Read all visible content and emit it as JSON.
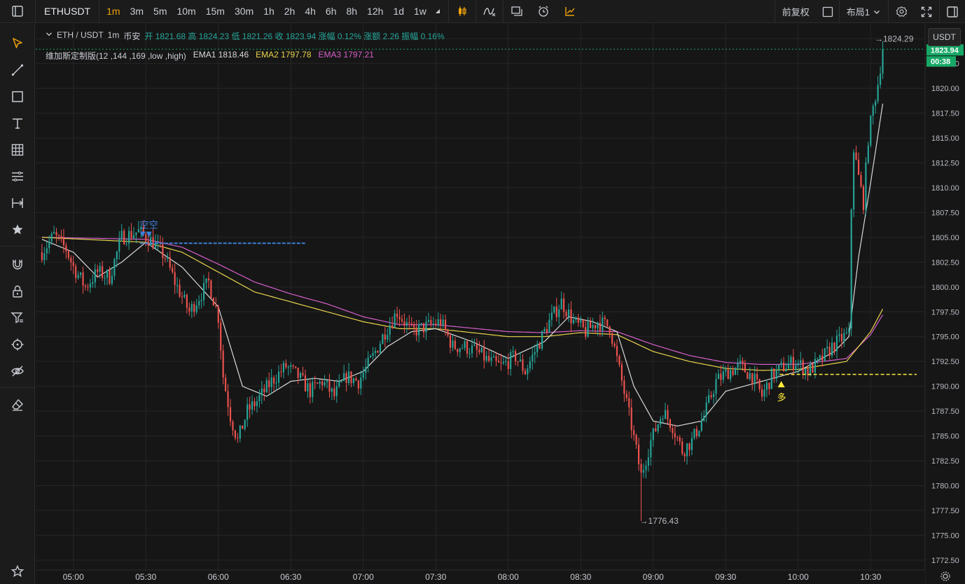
{
  "toolbar": {
    "symbol": "ETHUSDT",
    "intervals": [
      "1m",
      "3m",
      "5m",
      "10m",
      "15m",
      "30m",
      "1h",
      "2h",
      "4h",
      "6h",
      "8h",
      "12h",
      "1d",
      "1w"
    ],
    "active_interval": "1m",
    "adjust_label": "前复权",
    "layout_label": "布局1"
  },
  "legend": {
    "pair": "ETH / USDT",
    "interval": "1m",
    "exchange": "币安",
    "ohlc": "开 1821.68 高 1824.23 低 1821.26 收 1823.94 涨幅 0.12% 涨额 2.26 振幅 0.16%",
    "indicator": "维加斯定制版(12 ,144 ,169 ,low ,high)",
    "ema1_label": "EMA1 1818.46",
    "ema2_label": "EMA2 1797.78",
    "ema3_label": "EMA3 1797.21"
  },
  "currency": "USDT",
  "colors": {
    "up": "#26a69a",
    "down": "#ef5350",
    "ema1": "#d9d9d9",
    "ema2": "#e8d44d",
    "ema3": "#d65fcb",
    "price_tag": "#17a866"
  },
  "chart_data": {
    "type": "candlestick",
    "x_ticks": [
      "05:00",
      "05:30",
      "06:00",
      "06:30",
      "07:00",
      "07:30",
      "08:00",
      "08:30",
      "09:00",
      "09:30",
      "10:00",
      "10:30"
    ],
    "y_ticks": [
      1825.0,
      1822.5,
      1820.0,
      1817.5,
      1815.0,
      1812.5,
      1810.0,
      1807.5,
      1805.0,
      1802.5,
      1800.0,
      1797.5,
      1795.0,
      1792.5,
      1790.0,
      1787.5,
      1785.0,
      1782.5,
      1780.0,
      1777.5,
      1775.0,
      1772.5
    ],
    "ylim": [
      1771.5,
      1826.5
    ],
    "last_price": "1823.94",
    "countdown": "00:38",
    "high_label": "1824.29",
    "low_label": "1776.43",
    "short_signal": {
      "label": "空空",
      "time": "05:31",
      "price": 1804.8
    },
    "long_signal": {
      "label": "多",
      "time": "09:53",
      "price": 1790.6
    },
    "short_level": 1804.4,
    "long_level": 1791.2,
    "price_keyframes": [
      [
        "04:47",
        1803.5
      ],
      [
        "04:52",
        1805.2
      ],
      [
        "04:57",
        1803.8
      ],
      [
        "05:00",
        1802.0
      ],
      [
        "05:05",
        1800.0
      ],
      [
        "05:10",
        1801.5
      ],
      [
        "05:15",
        1801.0
      ],
      [
        "05:20",
        1805.0
      ],
      [
        "05:27",
        1805.6
      ],
      [
        "05:33",
        1804.5
      ],
      [
        "05:38",
        1803.0
      ],
      [
        "05:42",
        1800.5
      ],
      [
        "05:48",
        1797.5
      ],
      [
        "05:52",
        1799.0
      ],
      [
        "05:56",
        1800.5
      ],
      [
        "06:00",
        1797.0
      ],
      [
        "06:02",
        1791.0
      ],
      [
        "06:05",
        1787.0
      ],
      [
        "06:08",
        1784.5
      ],
      [
        "06:12",
        1787.5
      ],
      [
        "06:16",
        1788.5
      ],
      [
        "06:22",
        1790.5
      ],
      [
        "06:28",
        1792.0
      ],
      [
        "06:33",
        1791.0
      ],
      [
        "06:38",
        1789.5
      ],
      [
        "06:43",
        1790.5
      ],
      [
        "06:48",
        1789.0
      ],
      [
        "06:53",
        1791.0
      ],
      [
        "06:58",
        1790.5
      ],
      [
        "07:04",
        1793.0
      ],
      [
        "07:09",
        1795.5
      ],
      [
        "07:14",
        1797.5
      ],
      [
        "07:20",
        1795.5
      ],
      [
        "07:26",
        1796.0
      ],
      [
        "07:32",
        1796.5
      ],
      [
        "07:37",
        1794.0
      ],
      [
        "07:42",
        1794.0
      ],
      [
        "07:47",
        1793.5
      ],
      [
        "07:52",
        1792.5
      ],
      [
        "07:57",
        1792.0
      ],
      [
        "08:03",
        1793.0
      ],
      [
        "08:07",
        1791.5
      ],
      [
        "08:12",
        1794.0
      ],
      [
        "08:17",
        1796.5
      ],
      [
        "08:22",
        1798.5
      ],
      [
        "08:27",
        1796.5
      ],
      [
        "08:32",
        1795.5
      ],
      [
        "08:37",
        1796.5
      ],
      [
        "08:42",
        1796.0
      ],
      [
        "08:47",
        1790.5
      ],
      [
        "08:51",
        1786.0
      ],
      [
        "08:55",
        1781.0
      ],
      [
        "08:59",
        1784.5
      ],
      [
        "09:04",
        1787.5
      ],
      [
        "09:08",
        1786.0
      ],
      [
        "09:12",
        1783.5
      ],
      [
        "09:16",
        1784.5
      ],
      [
        "09:21",
        1787.0
      ],
      [
        "09:26",
        1790.5
      ],
      [
        "09:31",
        1791.5
      ],
      [
        "09:36",
        1792.0
      ],
      [
        "09:41",
        1791.0
      ],
      [
        "09:45",
        1789.0
      ],
      [
        "09:49",
        1791.0
      ],
      [
        "09:54",
        1792.0
      ],
      [
        "09:59",
        1792.5
      ],
      [
        "10:04",
        1791.5
      ],
      [
        "10:09",
        1792.5
      ],
      [
        "10:14",
        1794.0
      ],
      [
        "10:19",
        1795.0
      ],
      [
        "10:21",
        1795.2
      ],
      [
        "10:22",
        1808.0
      ],
      [
        "10:23",
        1814.0
      ],
      [
        "10:25",
        1811.0
      ],
      [
        "10:27",
        1808.5
      ],
      [
        "10:29",
        1815.0
      ],
      [
        "10:31",
        1818.0
      ],
      [
        "10:33",
        1820.5
      ],
      [
        "10:35",
        1823.94
      ]
    ],
    "ema1_keyframes": [
      [
        "04:47",
        1804.8
      ],
      [
        "05:00",
        1803.5
      ],
      [
        "05:10",
        1801.0
      ],
      [
        "05:20",
        1802.5
      ],
      [
        "05:30",
        1804.5
      ],
      [
        "05:45",
        1802.0
      ],
      [
        "06:00",
        1798.0
      ],
      [
        "06:10",
        1790.0
      ],
      [
        "06:20",
        1789.0
      ],
      [
        "06:30",
        1790.5
      ],
      [
        "06:40",
        1790.8
      ],
      [
        "06:50",
        1790.5
      ],
      [
        "07:00",
        1791.5
      ],
      [
        "07:10",
        1794.0
      ],
      [
        "07:20",
        1795.5
      ],
      [
        "07:30",
        1795.8
      ],
      [
        "07:45",
        1794.5
      ],
      [
        "08:00",
        1792.8
      ],
      [
        "08:15",
        1794.5
      ],
      [
        "08:25",
        1797.0
      ],
      [
        "08:35",
        1796.5
      ],
      [
        "08:45",
        1795.5
      ],
      [
        "08:52",
        1790.0
      ],
      [
        "09:00",
        1786.5
      ],
      [
        "09:10",
        1786.0
      ],
      [
        "09:20",
        1786.5
      ],
      [
        "09:30",
        1789.5
      ],
      [
        "09:45",
        1790.5
      ],
      [
        "10:00",
        1791.5
      ],
      [
        "10:15",
        1793.5
      ],
      [
        "10:21",
        1795.0
      ],
      [
        "10:25",
        1803.0
      ],
      [
        "10:30",
        1810.5
      ],
      [
        "10:35",
        1818.46
      ]
    ],
    "ema2_keyframes": [
      [
        "04:47",
        1805.0
      ],
      [
        "05:30",
        1804.5
      ],
      [
        "05:45",
        1803.5
      ],
      [
        "06:00",
        1801.5
      ],
      [
        "06:15",
        1799.5
      ],
      [
        "06:30",
        1798.5
      ],
      [
        "06:45",
        1797.5
      ],
      [
        "07:00",
        1796.5
      ],
      [
        "07:15",
        1795.8
      ],
      [
        "07:30",
        1795.8
      ],
      [
        "08:00",
        1795.0
      ],
      [
        "08:15",
        1795.0
      ],
      [
        "08:30",
        1795.4
      ],
      [
        "08:45",
        1795.2
      ],
      [
        "09:00",
        1793.5
      ],
      [
        "09:15",
        1792.5
      ],
      [
        "09:30",
        1791.8
      ],
      [
        "09:45",
        1791.6
      ],
      [
        "10:00",
        1791.7
      ],
      [
        "10:20",
        1792.5
      ],
      [
        "10:30",
        1795.5
      ],
      [
        "10:35",
        1797.78
      ]
    ],
    "ema3_keyframes": [
      [
        "04:47",
        1805.0
      ],
      [
        "05:30",
        1804.8
      ],
      [
        "05:45",
        1804.0
      ],
      [
        "06:00",
        1802.3
      ],
      [
        "06:15",
        1800.5
      ],
      [
        "06:30",
        1799.3
      ],
      [
        "06:45",
        1798.3
      ],
      [
        "07:00",
        1797.0
      ],
      [
        "07:15",
        1796.2
      ],
      [
        "07:30",
        1796.2
      ],
      [
        "08:00",
        1795.5
      ],
      [
        "08:15",
        1795.4
      ],
      [
        "08:30",
        1795.6
      ],
      [
        "08:45",
        1795.5
      ],
      [
        "09:00",
        1794.2
      ],
      [
        "09:15",
        1793.1
      ],
      [
        "09:30",
        1792.4
      ],
      [
        "09:45",
        1792.2
      ],
      [
        "10:00",
        1792.2
      ],
      [
        "10:20",
        1792.8
      ],
      [
        "10:30",
        1795.2
      ],
      [
        "10:35",
        1797.21
      ]
    ]
  }
}
